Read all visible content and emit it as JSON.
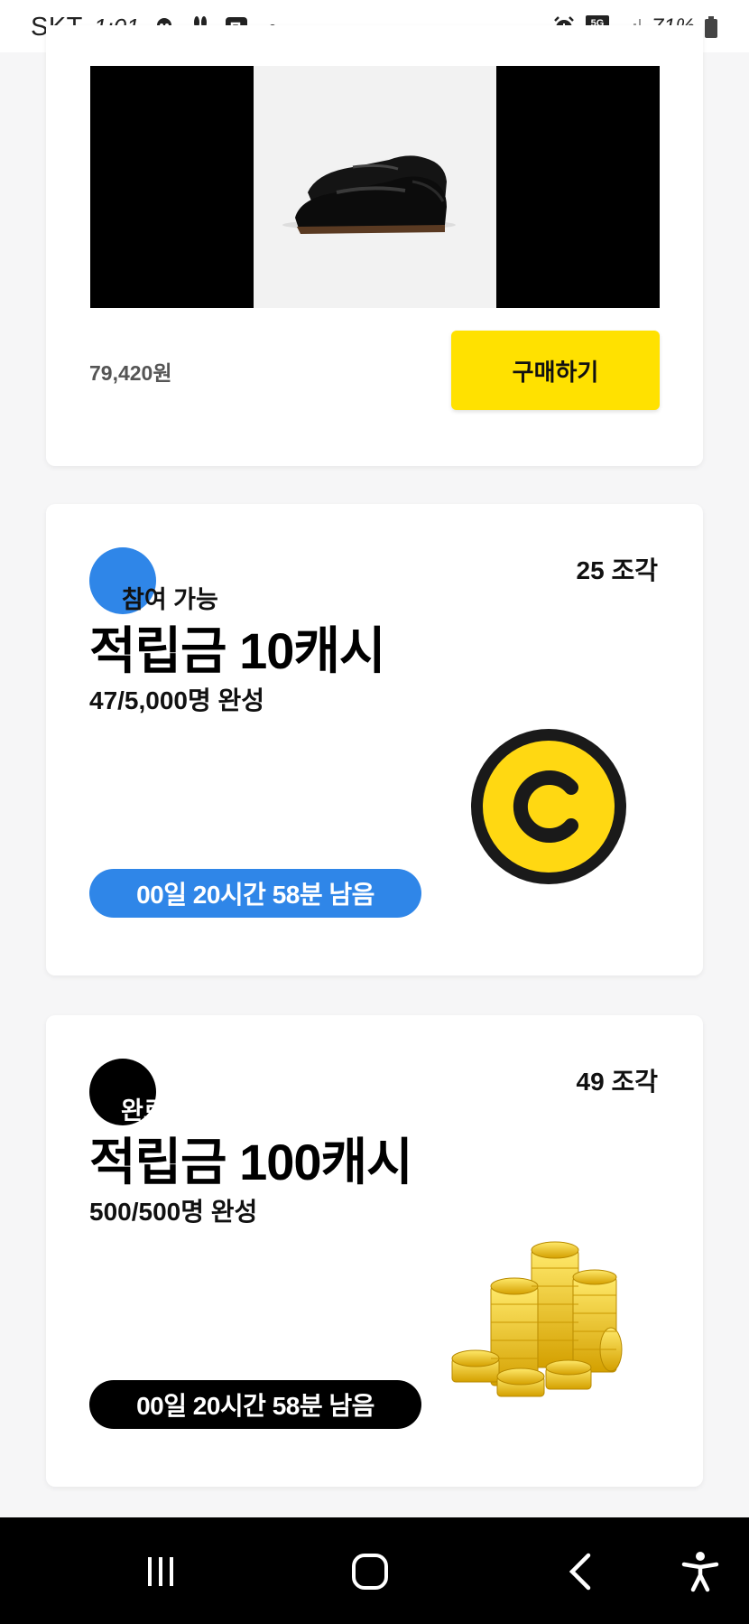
{
  "status_bar": {
    "carrier": "SKT",
    "time": "1:01",
    "network": "5G",
    "battery": "71%"
  },
  "product_card": {
    "price": "79,420원",
    "buy_label": "구매하기",
    "image_icon": "loafer-shoes-image"
  },
  "rewards": [
    {
      "status": "참여 가능",
      "status_color": "#2f86e8",
      "pieces": "25 조각",
      "title": "적립금 10캐시",
      "progress": "47/5,000명 완성",
      "timer": "00일 20시간 58분 남음",
      "timer_color": "#2f86e8",
      "image_icon": "yellow-coin-icon"
    },
    {
      "status": "완료",
      "status_color": "#000000",
      "pieces": "49 조각",
      "title": "적립금 100캐시",
      "progress": "500/500명 완성",
      "timer": "00일 20시간 58분 남음",
      "timer_color": "#000000",
      "image_icon": "gold-coin-stack-image"
    }
  ],
  "colors": {
    "accent_yellow": "#ffe100",
    "accent_blue": "#2f86e8"
  },
  "nav": {
    "recent_icon": "recent-apps-icon",
    "home_icon": "home-icon",
    "back_icon": "back-icon",
    "accessibility_icon": "accessibility-icon"
  }
}
